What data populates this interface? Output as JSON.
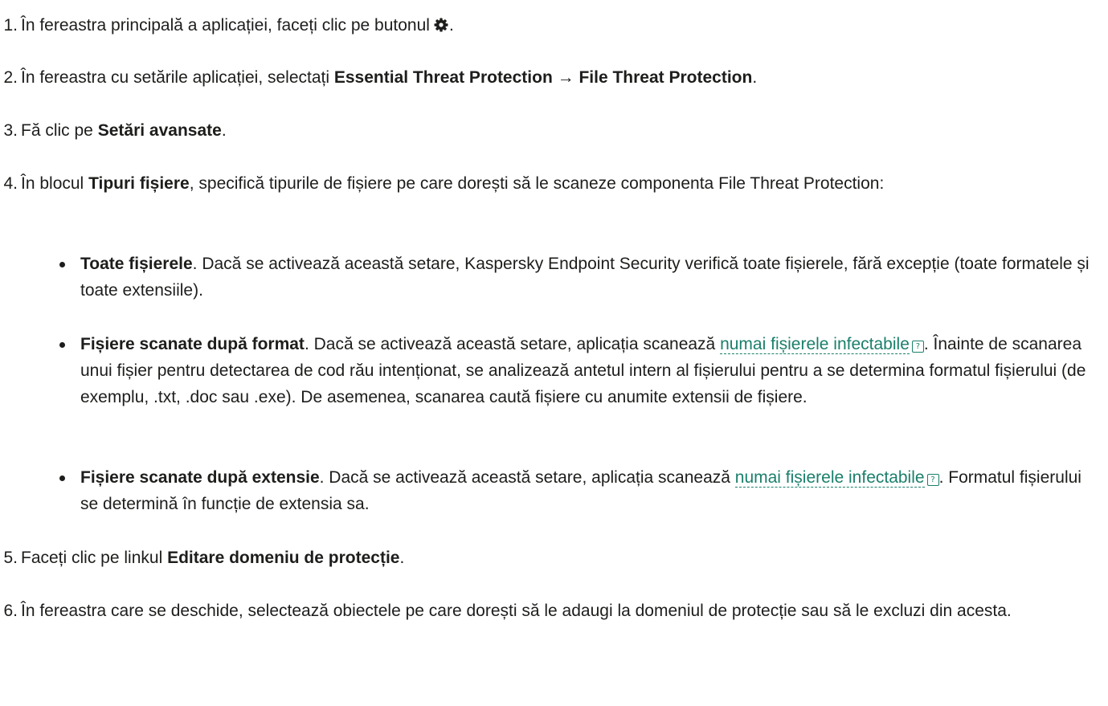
{
  "steps": [
    {
      "num": "1.",
      "before": "În fereastra principală a aplicației, faceți clic pe butonul",
      "after": "."
    },
    {
      "num": "2.",
      "before": "În fereastra cu setările aplicației, selectați",
      "bold1": "Essential Threat Protection",
      "arrow": "→",
      "bold2": "File Threat Protection",
      "after": "."
    },
    {
      "num": "3.",
      "before": "Fă clic pe",
      "bold": "Setări avansate",
      "after": "."
    },
    {
      "num": "4.",
      "before": "În blocul",
      "bold": "Tipuri fișiere",
      "after": ", specifică tipurile de fișiere pe care dorești să le scaneze componenta File Threat Protection:"
    },
    {
      "num": "5.",
      "before": "Faceți clic pe linkul",
      "bold": "Editare domeniu de protecție",
      "after": "."
    },
    {
      "num": "6.",
      "text": "În fereastra care se deschide, selectează obiectele pe care dorești să le adaugi la domeniul de protecție sau să le excluzi din acesta."
    }
  ],
  "bullets": [
    {
      "bold": "Toate fișierele",
      "text": ". Dacă se activează această setare, Kaspersky Endpoint Security verifică toate fișierele, fără excepție (toate formatele și toate extensiile)."
    },
    {
      "bold": "Fișiere scanate după format",
      "before": ". Dacă se activează această setare, aplicația scanează",
      "link": "numai fișierele infectabile",
      "after": ". Înainte de scanarea unui fișier pentru detectarea de cod rău intenționat, se analizează antetul intern al fișierului pentru a se determina formatul fișierului (de exemplu, .txt, .doc sau .exe). De asemenea, scanarea caută fișiere cu anumite extensii de fișiere."
    },
    {
      "bold": "Fișiere scanate după extensie",
      "before": ". Dacă se activează această setare, aplicația scanează",
      "link": "numai fișierele infectabile",
      "after": ". Formatul fișierului se determină în funcție de extensia sa."
    }
  ],
  "icons": {
    "settings": "gear-icon",
    "help": "help-icon",
    "help_glyph": "?"
  },
  "colors": {
    "text": "#1d1d1b",
    "link": "#1a7f6b"
  }
}
